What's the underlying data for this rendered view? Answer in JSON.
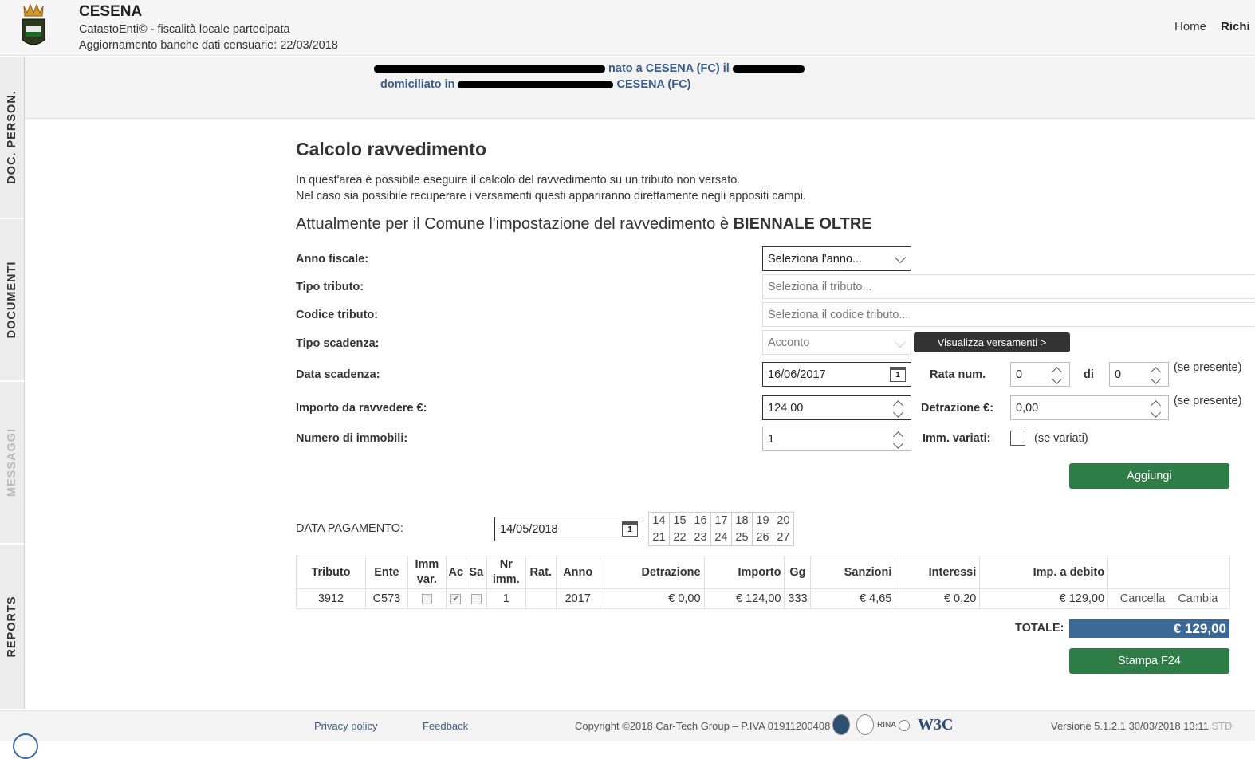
{
  "header": {
    "app_name": "CESENA",
    "subtitle": "CatastoEnti© - fiscalità locale partecipata",
    "update": "Aggiornamento banche dati censuarie: 22/03/2018",
    "nav_home": "Home",
    "nav_rich": "Richi"
  },
  "user": {
    "line1_suffix": "nato a CESENA (FC) il",
    "line2_prefix": "domiciliato in",
    "line2_suffix": "CESENA (FC)"
  },
  "sidebar": {
    "tabs": [
      "DOC. PERSON.",
      "DOCUMENTI",
      "MESSAGGI",
      "REPORTS"
    ]
  },
  "page": {
    "title": "Calcolo ravvedimento",
    "intro1": "In quest'area è possibile eseguire il calcolo del ravvedimento su un tributo non versato.",
    "intro2": "Nel caso sia possibile recuperare i versamenti questi appariranno direttamente negli appositi campi.",
    "setting_text": "Attualmente per il Comune l'impostazione del ravvedimento è",
    "setting_value": "BIENNALE OLTRE"
  },
  "form": {
    "anno_label": "Anno fiscale:",
    "anno_value": "Seleziona l'anno...",
    "tipo_tributo_label": "Tipo tributo:",
    "tipo_tributo_placeholder": "Seleziona il tributo...",
    "codice_label": "Codice tributo:",
    "codice_placeholder": "Seleziona il codice tributo...",
    "scadenza_label": "Tipo scadenza:",
    "scadenza_value": "Acconto",
    "visualizza_btn": "Visualizza versamenti >",
    "data_label": "Data scadenza:",
    "data_value": "16/06/2017",
    "rata_label": "Rata num.",
    "rata_value": "0",
    "di_label": "di",
    "di_value": "0",
    "se_presente": "(se presente)",
    "importo_label": "Importo da ravvedere €:",
    "importo_value": "124,00",
    "detrazione_label": "Detrazione €:",
    "detrazione_value": "0,00",
    "immobili_label": "Numero di immobili:",
    "immobili_value": "1",
    "imm_variati_label": "Imm. variati:",
    "se_variati": "(se variati)",
    "aggiungi_btn": "Aggiungi"
  },
  "payment": {
    "label": "DATA PAGAMENTO:",
    "value": "14/05/2018",
    "days_row1": [
      "14",
      "15",
      "16",
      "17",
      "18",
      "19",
      "20"
    ],
    "days_row2": [
      "21",
      "22",
      "23",
      "24",
      "25",
      "26",
      "27"
    ]
  },
  "table": {
    "headers": {
      "tributo": "Tributo",
      "ente": "Ente",
      "imm_var": "Imm var.",
      "ac": "Ac",
      "sa": "Sa",
      "nr_imm": "Nr imm.",
      "rat": "Rat.",
      "anno": "Anno",
      "detrazione": "Detrazione",
      "importo": "Importo",
      "gg": "Gg",
      "sanzioni": "Sanzioni",
      "interessi": "Interessi",
      "imp_debito": "Imp. a debito"
    },
    "row": {
      "tributo": "3912",
      "ente": "C573",
      "nr_imm": "1",
      "rat": "",
      "anno": "2017",
      "detrazione": "€ 0,00",
      "importo": "€ 124,00",
      "gg": "333",
      "sanzioni": "€ 4,65",
      "interessi": "€ 0,20",
      "imp_debito": "€ 129,00",
      "cancella": "Cancella",
      "cambia": "Cambia"
    },
    "totale_label": "TOTALE:",
    "totale_value": "€ 129,00",
    "stampa_btn": "Stampa F24"
  },
  "footer": {
    "privacy": "Privacy policy",
    "feedback": "Feedback",
    "copyright": "Copyright ©2018 Car-Tech Group – P.IVA 01911200408",
    "rina": "RINA",
    "w3c": "W3C",
    "version": "Versione 5.1.2.1 30/03/2018 13:11",
    "std": "STD"
  },
  "colors": {
    "accent_green": "#2e7d46",
    "total_blue": "#3c6897",
    "user_blue": "#3a5a8a"
  }
}
